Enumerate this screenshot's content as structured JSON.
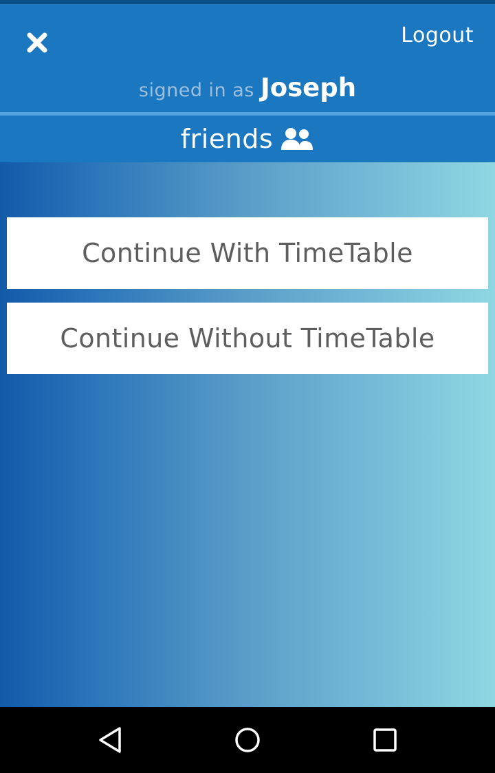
{
  "header": {
    "close_icon": "close-icon",
    "logout_label": "Logout",
    "signed_in_prefix": "signed in as",
    "username": "Joseph"
  },
  "friends": {
    "label": "friends",
    "icon": "users-icon"
  },
  "main": {
    "buttons": [
      {
        "label": "Continue With TimeTable"
      },
      {
        "label": "Continue Without TimeTable"
      }
    ]
  },
  "navbar": {
    "icons": [
      "back-triangle-icon",
      "home-circle-icon",
      "recents-square-icon"
    ]
  },
  "colors": {
    "header_blue": "#1c77c1",
    "gradient_start": "#135aa9",
    "gradient_end": "#8fd7e2",
    "button_text": "#5e5e5e"
  }
}
